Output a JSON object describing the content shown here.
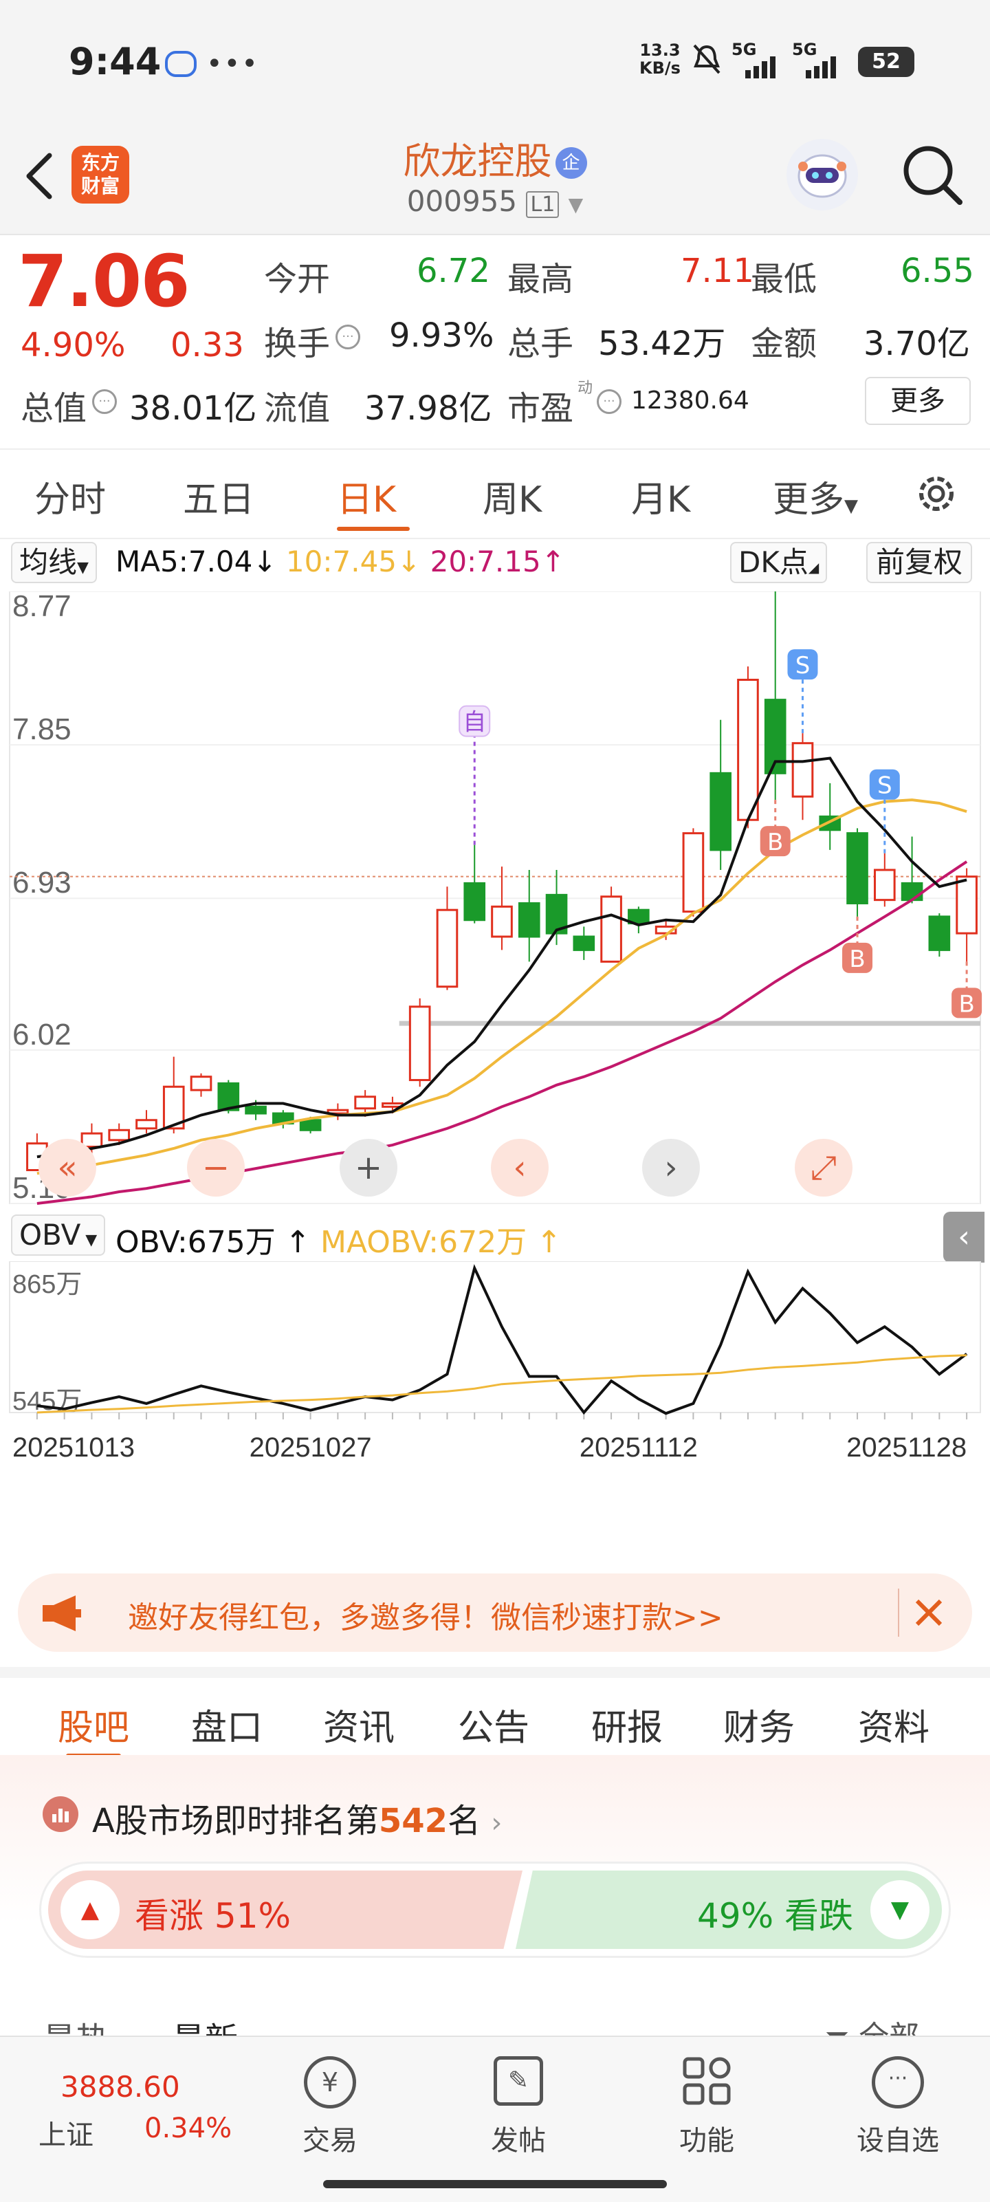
{
  "status_bar": {
    "time": "9:44",
    "net_speed_value": "13.3",
    "net_speed_unit": "KB/s",
    "net1": "5G",
    "net2": "5G",
    "battery": "52"
  },
  "header": {
    "logo_line1": "东方",
    "logo_line2": "财富",
    "stock_name": "欣龙控股",
    "name_badge": "企",
    "code": "000955",
    "level": "L1"
  },
  "quote": {
    "price": "7.06",
    "change_pct": "4.90%",
    "change": "0.33",
    "open_label": "今开",
    "open": "6.72",
    "high_label": "最高",
    "high": "7.11",
    "low_label": "最低",
    "low": "6.55",
    "turnover_label": "换手",
    "turnover": "9.93%",
    "volume_label": "总手",
    "volume": "53.42万",
    "amount_label": "金额",
    "amount": "3.70亿",
    "mktcap_label": "总值",
    "mktcap": "38.01亿",
    "float_label": "流值",
    "float_cap": "37.98亿",
    "pe_label": "市盈",
    "pe_sup": "动",
    "pe": "12380.64",
    "more_label": "更多"
  },
  "kline_tabs": [
    "分时",
    "五日",
    "日K",
    "周K",
    "月K",
    "更多"
  ],
  "chart_toolbar": {
    "ma_label": "均线",
    "ma5": "MA5:7.04",
    "ma10": "10:7.45",
    "ma20": "20:7.15",
    "dk_label": "DK点",
    "adjust_label": "前复权"
  },
  "colors": {
    "up": "#e0301e",
    "down": "#1a9a2a",
    "ma5": "#111111",
    "ma10": "#f0b83a",
    "ma20": "#c2186b",
    "accent": "#e25e1d"
  },
  "chart_data": [
    {
      "type": "candlestick",
      "ylim": [
        5.1,
        8.77
      ],
      "y_ticks": [
        "8.77",
        "7.85",
        "6.93",
        "6.02",
        "5.10"
      ],
      "x_ticks": [
        "20251013",
        "20251027",
        "20251112",
        "20251128"
      ],
      "ohlc": [
        [
          5.3,
          5.52,
          5.3,
          5.46
        ],
        [
          5.45,
          5.48,
          5.38,
          5.42
        ],
        [
          5.44,
          5.58,
          5.4,
          5.52
        ],
        [
          5.48,
          5.58,
          5.45,
          5.54
        ],
        [
          5.55,
          5.66,
          5.52,
          5.6
        ],
        [
          5.55,
          5.98,
          5.52,
          5.8
        ],
        [
          5.78,
          5.88,
          5.74,
          5.86
        ],
        [
          5.82,
          5.84,
          5.64,
          5.66
        ],
        [
          5.68,
          5.72,
          5.6,
          5.64
        ],
        [
          5.64,
          5.66,
          5.55,
          5.58
        ],
        [
          5.6,
          5.62,
          5.52,
          5.54
        ],
        [
          5.64,
          5.7,
          5.6,
          5.66
        ],
        [
          5.67,
          5.78,
          5.62,
          5.74
        ],
        [
          5.68,
          5.74,
          5.64,
          5.7
        ],
        [
          5.84,
          6.33,
          5.8,
          6.28
        ],
        [
          6.4,
          7.0,
          6.38,
          6.86
        ],
        [
          7.02,
          7.25,
          6.78,
          6.8
        ],
        [
          6.7,
          7.12,
          6.62,
          6.88
        ],
        [
          6.9,
          7.1,
          6.55,
          6.7
        ],
        [
          6.95,
          7.1,
          6.65,
          6.72
        ],
        [
          6.7,
          6.76,
          6.56,
          6.62
        ],
        [
          6.55,
          7.0,
          6.55,
          6.94
        ],
        [
          6.86,
          6.88,
          6.72,
          6.78
        ],
        [
          6.72,
          6.8,
          6.68,
          6.76
        ],
        [
          6.85,
          7.35,
          6.82,
          7.32
        ],
        [
          7.68,
          8.0,
          7.1,
          7.22
        ],
        [
          7.4,
          8.32,
          7.35,
          8.24
        ],
        [
          8.12,
          8.77,
          7.52,
          7.68
        ],
        [
          7.54,
          7.92,
          7.4,
          7.86
        ],
        [
          7.42,
          7.62,
          7.22,
          7.34
        ],
        [
          7.32,
          7.35,
          6.82,
          6.9
        ],
        [
          6.92,
          7.2,
          6.88,
          7.1
        ],
        [
          7.02,
          7.3,
          6.9,
          6.92
        ],
        [
          6.82,
          6.84,
          6.58,
          6.62
        ],
        [
          6.72,
          7.11,
          6.55,
          7.06
        ]
      ],
      "ma5": [
        5.38,
        5.4,
        5.43,
        5.46,
        5.51,
        5.57,
        5.63,
        5.67,
        5.7,
        5.7,
        5.66,
        5.63,
        5.63,
        5.65,
        5.75,
        5.93,
        6.07,
        6.29,
        6.5,
        6.74,
        6.79,
        6.83,
        6.77,
        6.8,
        6.79,
        6.95,
        7.4,
        7.75,
        7.75,
        7.77,
        7.51,
        7.34,
        7.15,
        7.0,
        7.04
      ],
      "ma10": [
        5.28,
        5.31,
        5.33,
        5.36,
        5.39,
        5.43,
        5.48,
        5.51,
        5.55,
        5.58,
        5.61,
        5.63,
        5.64,
        5.65,
        5.7,
        5.75,
        5.85,
        5.98,
        6.1,
        6.22,
        6.36,
        6.5,
        6.63,
        6.71,
        6.84,
        6.92,
        7.08,
        7.22,
        7.31,
        7.39,
        7.47,
        7.51,
        7.52,
        7.5,
        7.45
      ],
      "ma20": [
        5.1,
        5.12,
        5.14,
        5.17,
        5.19,
        5.22,
        5.25,
        5.28,
        5.31,
        5.34,
        5.37,
        5.4,
        5.42,
        5.45,
        5.5,
        5.55,
        5.61,
        5.68,
        5.74,
        5.81,
        5.86,
        5.92,
        5.99,
        6.06,
        6.13,
        6.21,
        6.32,
        6.43,
        6.53,
        6.62,
        6.72,
        6.82,
        6.92,
        7.04,
        7.15
      ],
      "signals": [
        {
          "index": 16,
          "label": "自",
          "kind": "self"
        },
        {
          "index": 27,
          "label": "B",
          "kind": "buy"
        },
        {
          "index": 28,
          "label": "S",
          "kind": "sell"
        },
        {
          "index": 30,
          "label": "B",
          "kind": "buy"
        },
        {
          "index": 31,
          "label": "S",
          "kind": "sell"
        },
        {
          "index": 34,
          "label": "B",
          "kind": "buy"
        }
      ]
    },
    {
      "type": "line",
      "y_ticks": [
        "865万",
        "545万"
      ],
      "ylim": [
        545,
        865
      ],
      "series": [
        {
          "name": "OBV",
          "values": [
            560,
            553,
            567,
            580,
            565,
            585,
            604,
            590,
            577,
            565,
            550,
            565,
            580,
            573,
            595,
            630,
            865,
            735,
            625,
            625,
            545,
            615,
            575,
            543,
            565,
            695,
            857,
            745,
            820,
            765,
            700,
            735,
            690,
            630,
            675
          ]
        },
        {
          "name": "MAOBV",
          "values": [
            545,
            548,
            551,
            553,
            556,
            560,
            563,
            566,
            569,
            571,
            573,
            576,
            580,
            583,
            588,
            592,
            598,
            608,
            612,
            616,
            619,
            622,
            626,
            628,
            630,
            633,
            640,
            645,
            648,
            652,
            656,
            662,
            666,
            670,
            672
          ]
        }
      ]
    }
  ],
  "indicator": {
    "name": "OBV",
    "obv": "OBV:675万",
    "maobv": "MAOBV:672万"
  },
  "banner": {
    "text": "邀好友得红包，多邀多得！微信秒速打款>>"
  },
  "section_tabs": [
    "股吧",
    "盘口",
    "资讯",
    "公告",
    "研报",
    "财务",
    "资料"
  ],
  "ranking": {
    "prefix": "A股市场即时排名第",
    "rank": "542",
    "suffix": "名"
  },
  "sentiment": {
    "up_label": "看涨 51%",
    "up": 51,
    "down_label": "49% 看跌",
    "down": 49
  },
  "feed_tabs": {
    "hot": "最热",
    "latest": "最新",
    "all": "全部"
  },
  "bottom_nav": {
    "index_value": "3888.60",
    "index_name": "上证",
    "index_change": "0.34%",
    "items": [
      "交易",
      "发帖",
      "功能",
      "设自选"
    ]
  }
}
